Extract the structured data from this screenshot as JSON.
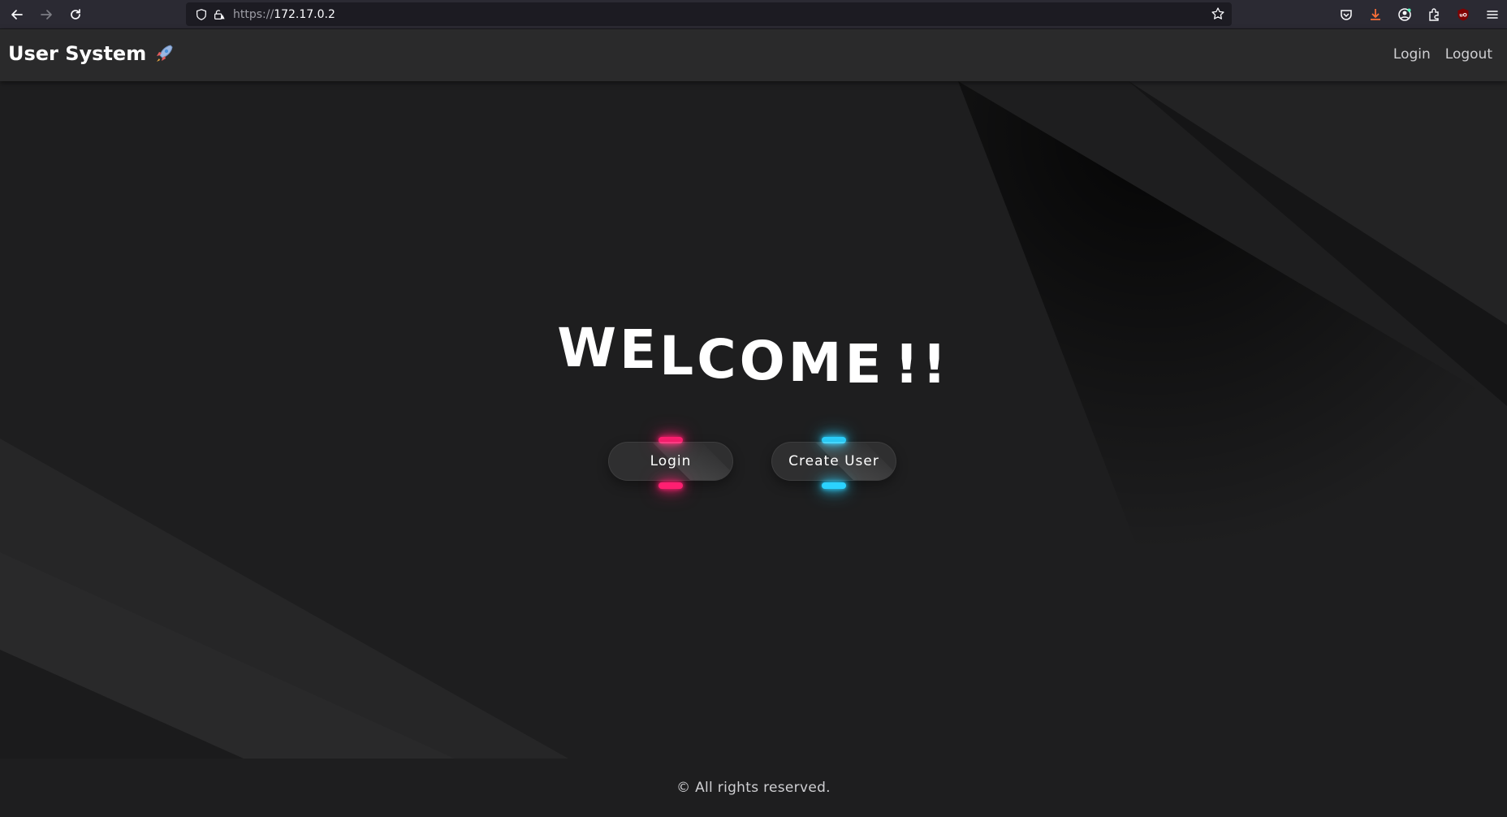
{
  "browser": {
    "url_scheme": "https://",
    "url_host": "172.17.0.2"
  },
  "navbar": {
    "brand": "User System",
    "brand_icon": "rocket-icon",
    "links": [
      {
        "label": "Login"
      },
      {
        "label": "Logout"
      }
    ]
  },
  "hero": {
    "title_letters": [
      "W",
      "E",
      "L",
      "C",
      "O",
      "M",
      "E",
      " ",
      "!",
      "!"
    ],
    "buttons": {
      "login_label": "Login",
      "create_label": "Create User"
    },
    "glow_colors": {
      "login": "#ff1f71",
      "create": "#2bd2ff"
    }
  },
  "footer": {
    "text": "© All rights reserved."
  }
}
